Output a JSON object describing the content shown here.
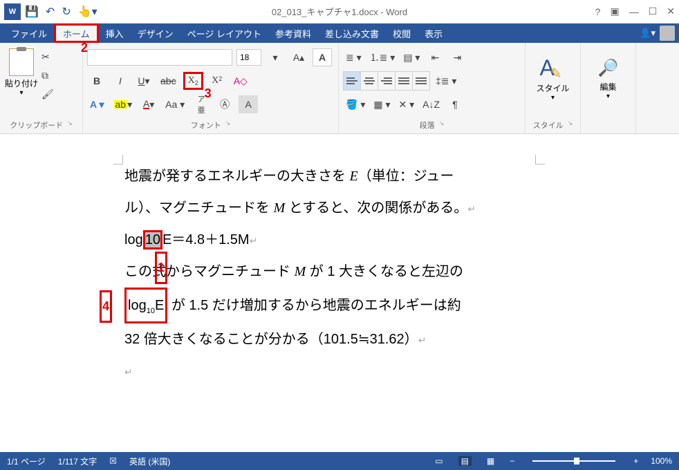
{
  "titlebar": {
    "title": "02_013_キャプチャ1.docx - Word"
  },
  "tabs": {
    "file": "ファイル",
    "home": "ホーム",
    "insert": "挿入",
    "design": "デザイン",
    "layout": "ページ レイアウト",
    "references": "参考資料",
    "mailings": "差し込み文書",
    "review": "校閲",
    "view": "表示"
  },
  "ribbon": {
    "clipboard": {
      "label": "クリップボード",
      "paste": "貼り付け"
    },
    "font": {
      "label": "フォント",
      "family": "",
      "size": "18"
    },
    "paragraph": {
      "label": "段落"
    },
    "styles": {
      "label": "スタイル",
      "button": "スタイル"
    },
    "editing": {
      "label": "",
      "button": "編集"
    }
  },
  "callouts": {
    "n1": "1",
    "n2": "2",
    "n3": "3",
    "n4": "4"
  },
  "document": {
    "line1a": "地震が発するエネルギーの大きさを ",
    "line1_E": "E",
    "line1b": "（単位：ジュー",
    "line2a": "ル）、マグニチュードを ",
    "line2_M": "M",
    "line2b": " とすると、次の関係がある。",
    "line3_log": "log",
    "line3_sel10": "10",
    "line3_rest": "E＝4.8＋1.5M",
    "line4a": "この式からマグニチュード ",
    "line4_M": "M",
    "line4b": " が 1 大きくなると左辺の",
    "line5_log": "log",
    "line5_sub10": "10",
    "line5_E": "E",
    "line5_rest": " が 1.5 だけ増加するから地震のエネルギーは約",
    "line6": "32 倍大きくなることが分かる（101.5≒31.62）"
  },
  "status": {
    "page": "1/1 ページ",
    "words": "1/117 文字",
    "lang": "英語 (米国)",
    "zoom": "100%"
  }
}
